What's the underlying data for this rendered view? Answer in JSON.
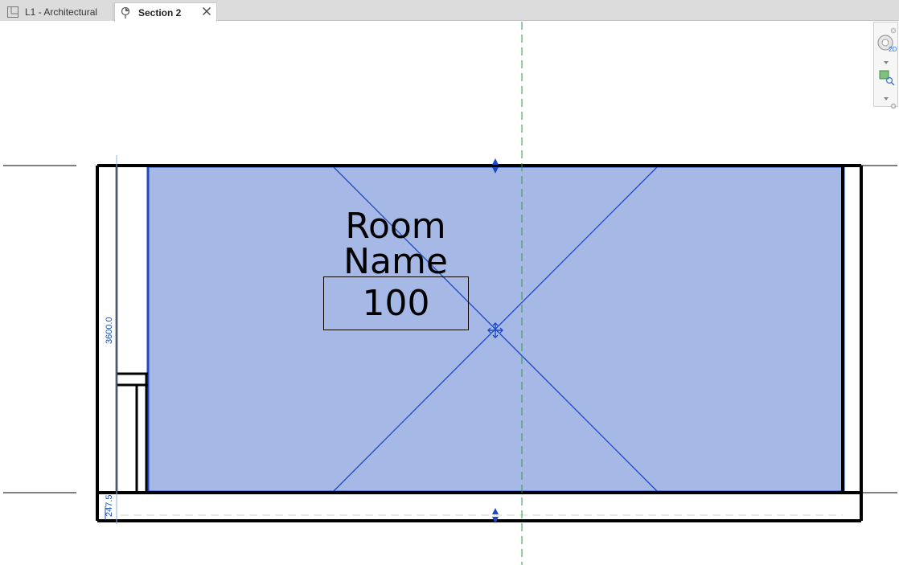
{
  "tabs": [
    {
      "label": "L1 - Architectural",
      "icon": "floor-plan-icon",
      "active": false
    },
    {
      "label": "Section 2",
      "icon": "section-view-icon",
      "active": true
    }
  ],
  "tab_close_icon": "close-icon",
  "navigation_bar": {
    "items": [
      "steering-wheel-2d-icon",
      "zoom-region-icon"
    ]
  },
  "room": {
    "name": "Room Name",
    "number": "100"
  },
  "dimensions": {
    "height": "3600.0",
    "offset": "247.5"
  },
  "colors": {
    "room_fill": "#a5b8e6",
    "selection": "#1f49c4",
    "level_line": "#000000",
    "grid_line": "#2e9a3f",
    "tab_bar": "#dcdcdc"
  }
}
